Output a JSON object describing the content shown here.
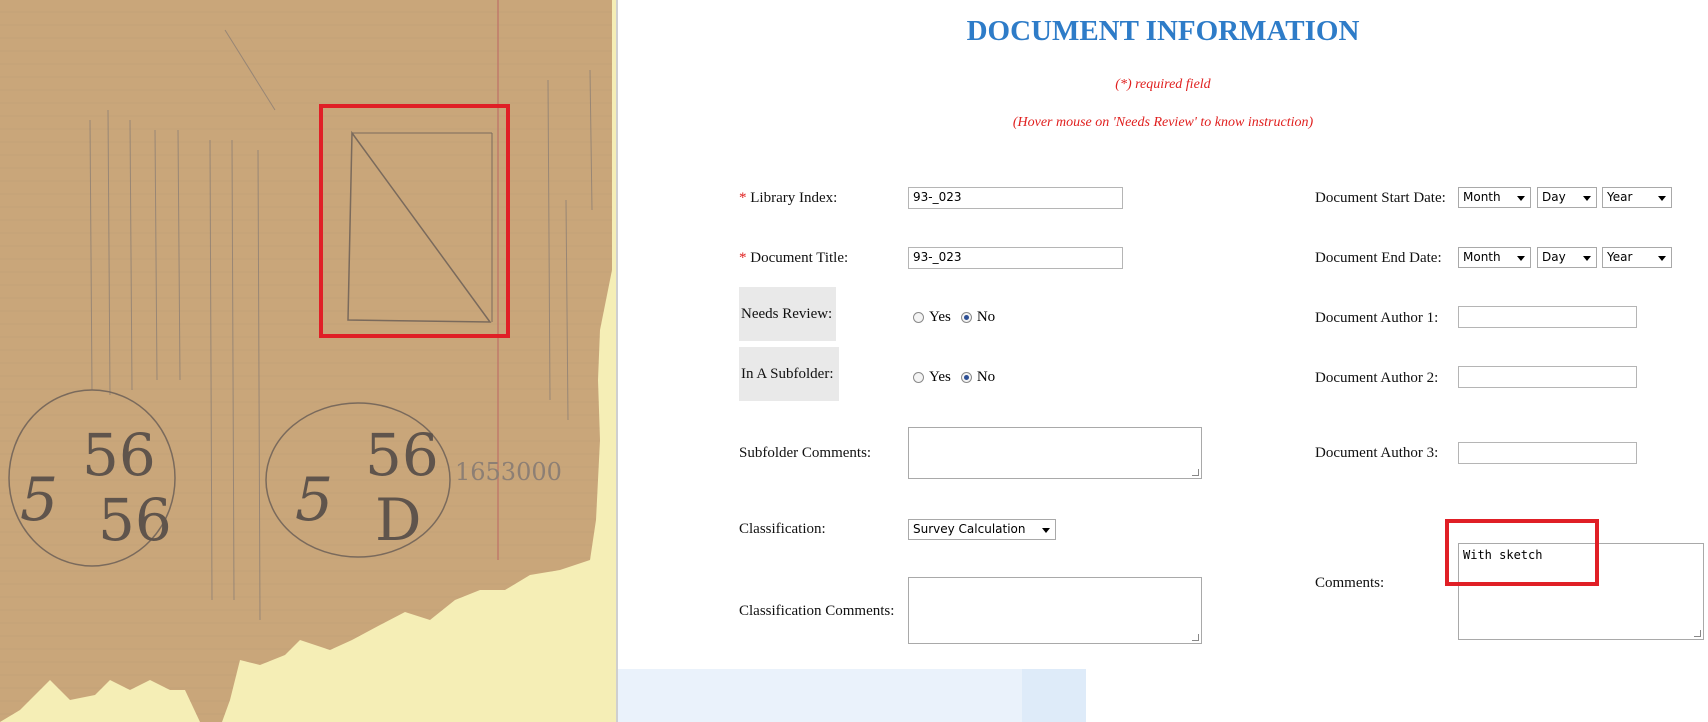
{
  "form": {
    "title": "DOCUMENT INFORMATION",
    "required_note": "(*) required field",
    "hover_note": "(Hover mouse on 'Needs Review' to know instruction)",
    "fields": {
      "library_index": {
        "label": "Library Index:",
        "value": "93-_023",
        "required_mark": "*"
      },
      "document_title": {
        "label": "Document Title:",
        "value": "93-_023",
        "required_mark": "*"
      },
      "needs_review": {
        "label": "Needs Review:",
        "options": [
          "Yes",
          "No"
        ],
        "selected": "No"
      },
      "in_subfolder": {
        "label": "In A Subfolder:",
        "options": [
          "Yes",
          "No"
        ],
        "selected": "No"
      },
      "subfolder_comments": {
        "label": "Subfolder Comments:",
        "value": ""
      },
      "classification": {
        "label": "Classification:",
        "value": "Survey Calculation"
      },
      "classification_comments": {
        "label": "Classification Comments:",
        "value": ""
      },
      "start_date": {
        "label": "Document Start Date:",
        "month": "Month",
        "day": "Day",
        "year": "Year"
      },
      "end_date": {
        "label": "Document End Date:",
        "month": "Month",
        "day": "Day",
        "year": "Year"
      },
      "author1": {
        "label": "Document Author 1:",
        "value": ""
      },
      "author2": {
        "label": "Document Author 2:",
        "value": ""
      },
      "author3": {
        "label": "Document Author 3:",
        "value": ""
      },
      "comments": {
        "label": "Comments:",
        "value": "With sketch"
      }
    }
  },
  "colors": {
    "title_blue": "#2e7cc8",
    "required_red": "#e0201f",
    "highlight_red": "#e01f26",
    "paper_brown": "#c9a67a",
    "page_background": "#f5eeb6"
  }
}
